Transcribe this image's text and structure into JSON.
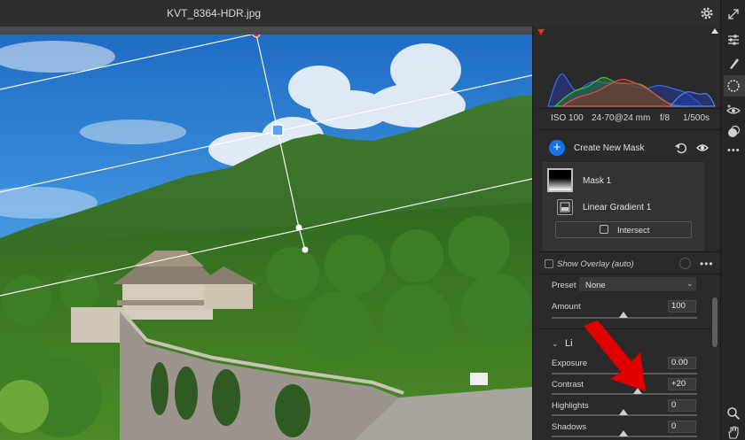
{
  "title": {
    "filename": "KVT_8364-HDR.jpg"
  },
  "exif": {
    "iso": "ISO 100",
    "lens": "24-70@24 mm",
    "aperture": "f/8",
    "shutter": "1/500s"
  },
  "masks": {
    "create_label": "Create New Mask",
    "mask_name": "Mask 1",
    "component": "Linear Gradient 1",
    "intersect_label": "Intersect"
  },
  "overlay": {
    "label": "Show Overlay (auto)"
  },
  "preset": {
    "label": "Preset",
    "value": "None"
  },
  "sliders": [
    {
      "label": "Amount",
      "value": "100",
      "level": 0.5
    },
    {
      "label": "Exposure",
      "value": "0.00",
      "level": 0.5
    },
    {
      "label": "Contrast",
      "value": "+20",
      "level": 0.6
    },
    {
      "label": "Highlights",
      "value": "0",
      "level": 0.5
    },
    {
      "label": "Shadows",
      "value": "0",
      "level": 0.5
    }
  ],
  "section": {
    "light_label": "Li"
  },
  "colors": {
    "accent": "#1473e6",
    "arrow": "#e00000",
    "handle": "#e03030"
  },
  "icons": [
    "settings-gear-icon",
    "collapse-icon",
    "sliders-icon",
    "brush-icon",
    "bandage-icon",
    "masking-icon",
    "redeye-icon",
    "presets-icon",
    "more-icon",
    "zoom-icon",
    "hand-icon"
  ]
}
